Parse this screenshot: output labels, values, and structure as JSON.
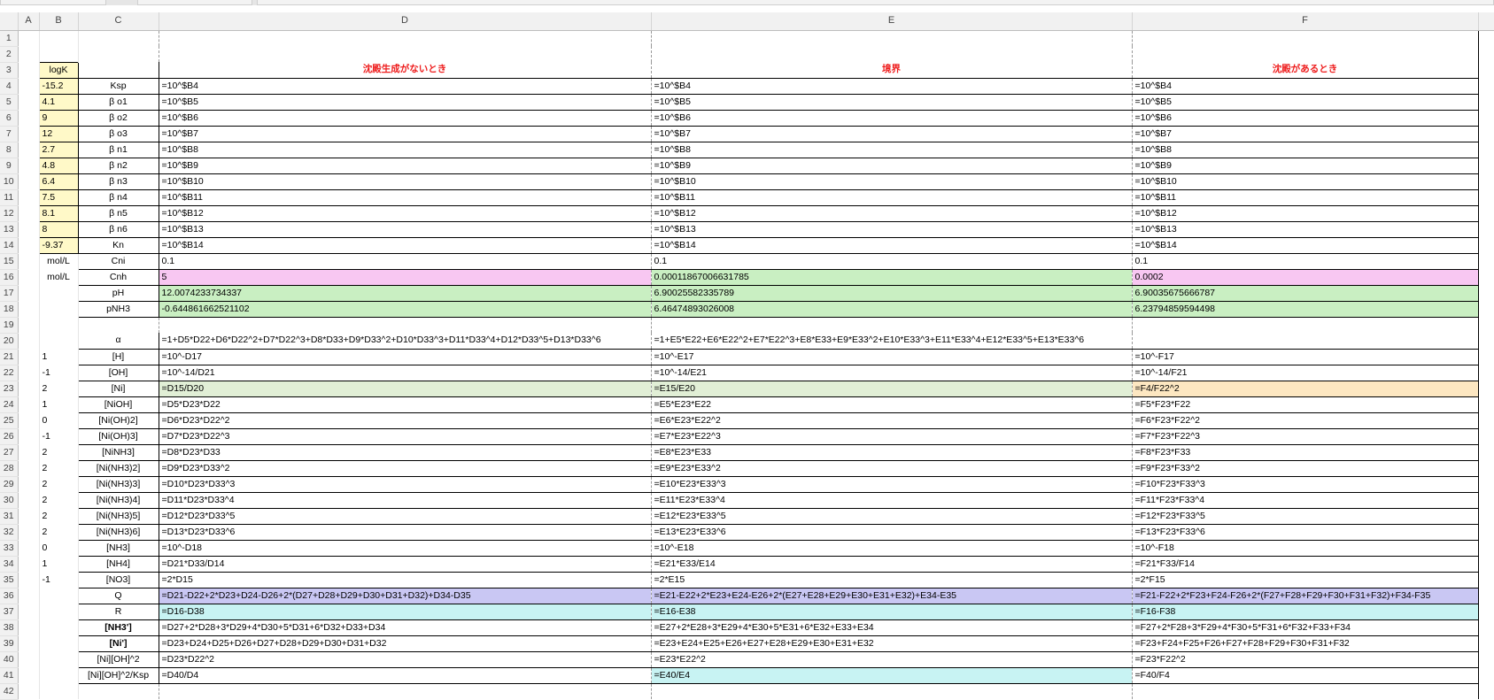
{
  "columns": [
    "",
    "A",
    "B",
    "C",
    "D",
    "E",
    "F"
  ],
  "rows": [
    {
      "n": "1",
      "b": "",
      "c": "",
      "d": "",
      "e": "",
      "f": ""
    },
    {
      "n": "2",
      "b": "",
      "c": "",
      "d": "",
      "e": "",
      "f": ""
    },
    {
      "n": "3",
      "b": "logK",
      "c": "",
      "d": "沈殿生成がないとき",
      "e": "境界",
      "f": "沈殿があるとき"
    },
    {
      "n": "4",
      "b": "-15.2",
      "c": "Ksp",
      "d": "=10^$B4",
      "e": "=10^$B4",
      "f": "=10^$B4"
    },
    {
      "n": "5",
      "b": "4.1",
      "c": "β o1",
      "d": "=10^$B5",
      "e": "=10^$B5",
      "f": "=10^$B5"
    },
    {
      "n": "6",
      "b": "9",
      "c": "β o2",
      "d": "=10^$B6",
      "e": "=10^$B6",
      "f": "=10^$B6"
    },
    {
      "n": "7",
      "b": "12",
      "c": "β o3",
      "d": "=10^$B7",
      "e": "=10^$B7",
      "f": "=10^$B7"
    },
    {
      "n": "8",
      "b": "2.7",
      "c": "β n1",
      "d": "=10^$B8",
      "e": "=10^$B8",
      "f": "=10^$B8"
    },
    {
      "n": "9",
      "b": "4.8",
      "c": "β n2",
      "d": "=10^$B9",
      "e": "=10^$B9",
      "f": "=10^$B9"
    },
    {
      "n": "10",
      "b": "6.4",
      "c": "β n3",
      "d": "=10^$B10",
      "e": "=10^$B10",
      "f": "=10^$B10"
    },
    {
      "n": "11",
      "b": "7.5",
      "c": "β n4",
      "d": "=10^$B11",
      "e": "=10^$B11",
      "f": "=10^$B11"
    },
    {
      "n": "12",
      "b": "8.1",
      "c": "β n5",
      "d": "=10^$B12",
      "e": "=10^$B12",
      "f": "=10^$B12"
    },
    {
      "n": "13",
      "b": "8",
      "c": "β n6",
      "d": "=10^$B13",
      "e": "=10^$B13",
      "f": "=10^$B13"
    },
    {
      "n": "14",
      "b": "-9.37",
      "c": "Kn",
      "d": "=10^$B14",
      "e": "=10^$B14",
      "f": "=10^$B14"
    },
    {
      "n": "15",
      "b": "mol/L",
      "c": "Cni",
      "d": "0.1",
      "e": "0.1",
      "f": "0.1"
    },
    {
      "n": "16",
      "b": "mol/L",
      "c": "Cnh",
      "d": "5",
      "e": "0.00011867006631785",
      "f": "0.0002"
    },
    {
      "n": "17",
      "b": "",
      "c": "pH",
      "d": "12.0074233734337",
      "e": "6.90025582335789",
      "f": "6.90035675666787"
    },
    {
      "n": "18",
      "b": "",
      "c": "pNH3",
      "d": "-0.644861662521102",
      "e": "6.46474893026008",
      "f": "6.23794859594498"
    },
    {
      "n": "19",
      "b": "",
      "c": "",
      "d": "",
      "e": "",
      "f": ""
    },
    {
      "n": "20",
      "b": "",
      "c": "α",
      "d": "=1+D5*D22+D6*D22^2+D7*D22^3+D8*D33+D9*D33^2+D10*D33^3+D11*D33^4+D12*D33^5+D13*D33^6",
      "e": "=1+E5*E22+E6*E22^2+E7*E22^3+E8*E33+E9*E33^2+E10*E33^3+E11*E33^4+E12*E33^5+E13*E33^6",
      "f": ""
    },
    {
      "n": "21",
      "b": "1",
      "c": "[H]",
      "d": "=10^-D17",
      "e": "=10^-E17",
      "f": "=10^-F17"
    },
    {
      "n": "22",
      "b": "-1",
      "c": "[OH]",
      "d": "=10^-14/D21",
      "e": "=10^-14/E21",
      "f": "=10^-14/F21"
    },
    {
      "n": "23",
      "b": "2",
      "c": "[Ni]",
      "d": "=D15/D20",
      "e": "=E15/E20",
      "f": "=F4/F22^2"
    },
    {
      "n": "24",
      "b": "1",
      "c": "[NiOH]",
      "d": "=D5*D23*D22",
      "e": "=E5*E23*E22",
      "f": "=F5*F23*F22"
    },
    {
      "n": "25",
      "b": "0",
      "c": "[Ni(OH)2]",
      "d": "=D6*D23*D22^2",
      "e": "=E6*E23*E22^2",
      "f": "=F6*F23*F22^2"
    },
    {
      "n": "26",
      "b": "-1",
      "c": "[Ni(OH)3]",
      "d": "=D7*D23*D22^3",
      "e": "=E7*E23*E22^3",
      "f": "=F7*F23*F22^3"
    },
    {
      "n": "27",
      "b": "2",
      "c": "[NiNH3]",
      "d": "=D8*D23*D33",
      "e": "=E8*E23*E33",
      "f": "=F8*F23*F33"
    },
    {
      "n": "28",
      "b": "2",
      "c": "[Ni(NH3)2]",
      "d": "=D9*D23*D33^2",
      "e": "=E9*E23*E33^2",
      "f": "=F9*F23*F33^2"
    },
    {
      "n": "29",
      "b": "2",
      "c": "[Ni(NH3)3]",
      "d": "=D10*D23*D33^3",
      "e": "=E10*E23*E33^3",
      "f": "=F10*F23*F33^3"
    },
    {
      "n": "30",
      "b": "2",
      "c": "[Ni(NH3)4]",
      "d": "=D11*D23*D33^4",
      "e": "=E11*E23*E33^4",
      "f": "=F11*F23*F33^4"
    },
    {
      "n": "31",
      "b": "2",
      "c": "[Ni(NH3)5]",
      "d": "=D12*D23*D33^5",
      "e": "=E12*E23*E33^5",
      "f": "=F12*F23*F33^5"
    },
    {
      "n": "32",
      "b": "2",
      "c": "[Ni(NH3)6]",
      "d": "=D13*D23*D33^6",
      "e": "=E13*E23*E33^6",
      "f": "=F13*F23*F33^6"
    },
    {
      "n": "33",
      "b": "0",
      "c": "[NH3]",
      "d": "=10^-D18",
      "e": "=10^-E18",
      "f": "=10^-F18"
    },
    {
      "n": "34",
      "b": "1",
      "c": "[NH4]",
      "d": "=D21*D33/D14",
      "e": "=E21*E33/E14",
      "f": "=F21*F33/F14"
    },
    {
      "n": "35",
      "b": "-1",
      "c": "[NO3]",
      "d": "=2*D15",
      "e": "=2*E15",
      "f": "=2*F15"
    },
    {
      "n": "36",
      "b": "",
      "c": "Q",
      "d": "=D21-D22+2*D23+D24-D26+2*(D27+D28+D29+D30+D31+D32)+D34-D35",
      "e": "=E21-E22+2*E23+E24-E26+2*(E27+E28+E29+E30+E31+E32)+E34-E35",
      "f": "=F21-F22+2*F23+F24-F26+2*(F27+F28+F29+F30+F31+F32)+F34-F35"
    },
    {
      "n": "37",
      "b": "",
      "c": "R",
      "d": "=D16-D38",
      "e": "=E16-E38",
      "f": "=F16-F38"
    },
    {
      "n": "38",
      "b": "",
      "c": "[NH3']",
      "d": "=D27+2*D28+3*D29+4*D30+5*D31+6*D32+D33+D34",
      "e": "=E27+2*E28+3*E29+4*E30+5*E31+6*E32+E33+E34",
      "f": "=F27+2*F28+3*F29+4*F30+5*F31+6*F32+F33+F34"
    },
    {
      "n": "39",
      "b": "",
      "c": "[Ni']",
      "d": "=D23+D24+D25+D26+D27+D28+D29+D30+D31+D32",
      "e": "=E23+E24+E25+E26+E27+E28+E29+E30+E31+E32",
      "f": "=F23+F24+F25+F26+F27+F28+F29+F30+F31+F32"
    },
    {
      "n": "40",
      "b": "",
      "c": "[Ni][OH]^2",
      "d": "=D23*D22^2",
      "e": "=E23*E22^2",
      "f": "=F23*F22^2"
    },
    {
      "n": "41",
      "b": "",
      "c": "[Ni][OH]^2/Ksp",
      "d": "=D40/D4",
      "e": "=E40/E4",
      "f": "=F40/F4"
    },
    {
      "n": "42",
      "b": "",
      "c": "",
      "d": "",
      "e": "",
      "f": ""
    }
  ],
  "colors": {
    "header_red": "#ee1c1c",
    "logk_fill": "#fff9c8",
    "pink": "#f8c7f2",
    "green": "#c9efc2",
    "light_green": "#e1efd6",
    "blue": "#c9c7f3",
    "cyan": "#c8f3f3",
    "peach": "#fde7c1"
  }
}
